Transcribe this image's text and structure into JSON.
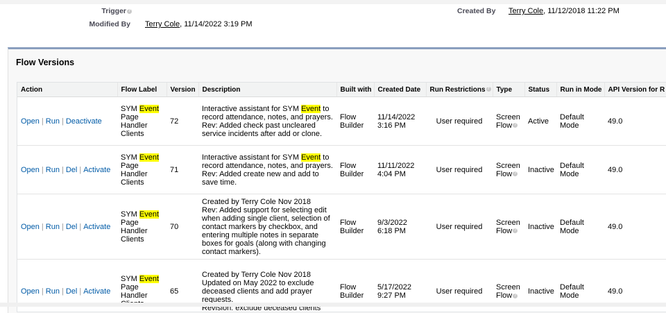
{
  "detail": {
    "trigger_label": "Trigger",
    "created_by_label": "Created By",
    "created_by_user": "Terry Cole",
    "created_by_date": ", 11/12/2018 11:22 PM",
    "modified_by_label": "Modified By",
    "modified_by_user": "Terry Cole",
    "modified_by_date": ", 11/14/2022 3:19 PM"
  },
  "section": {
    "title": "Flow Versions"
  },
  "table": {
    "headers": {
      "action": "Action",
      "flow_label": "Flow Label",
      "version": "Version",
      "description": "Description",
      "built_with": "Built with",
      "created_date": "Created Date",
      "run_restrictions": "Run Restrictions",
      "type": "Type",
      "status": "Status",
      "run_in_mode": "Run in Mode",
      "api_version": "API Version for R"
    },
    "action_labels": {
      "open": "Open",
      "run": "Run",
      "deactivate": "Deactivate",
      "del": "Del",
      "activate": "Activate"
    },
    "highlight_term": "Event",
    "rows": [
      {
        "label_pre": "SYM ",
        "label_post": " Page Handler Clients",
        "version": "72",
        "desc_pre": "Interactive assistant for SYM ",
        "desc_post": " to record attendance, notes, and prayers.",
        "desc_rev": "Rev: Added check past uncleared service incidents after add or clone.",
        "built_with": "Flow Builder",
        "created_date": "11/14/2022 3:16 PM",
        "run_restrictions": "User required",
        "type": "Screen Flow",
        "status": "Active",
        "run_in_mode": "Default Mode",
        "api_version": "49.0"
      },
      {
        "label_pre": "SYM ",
        "label_post": " Page Handler Clients",
        "version": "71",
        "desc_pre": "Interactive assistant for SYM ",
        "desc_post": " to record attendance, notes, and prayers.",
        "desc_rev": "Rev: Added create new and add to save time.",
        "built_with": "Flow Builder",
        "created_date": "11/11/2022 4:04 PM",
        "run_restrictions": "User required",
        "type": "Screen Flow",
        "status": "Inactive",
        "run_in_mode": "Default Mode",
        "api_version": "49.0"
      },
      {
        "label_pre": "SYM ",
        "label_post": " Page Handler Clients",
        "version": "70",
        "desc_line1": "Created by Terry Cole Nov 2018",
        "desc_line2": "Rev: Added support for selecting edit when adding single client, selection of contact markers by checkbox, and entering multiple notes in separate boxes for goals (along with changing contact markers).",
        "built_with": "Flow Builder",
        "created_date": "9/3/2022 6:18 PM",
        "run_restrictions": "User required",
        "type": "Screen Flow",
        "status": "Inactive",
        "run_in_mode": "Default Mode",
        "api_version": "49.0"
      },
      {
        "label_pre": "SYM ",
        "label_post": " Page Handler Clients",
        "version": "65",
        "desc_line1": "Created by Terry Cole Nov 2018",
        "desc_line2": "Updated on May 2022 to exclude deceased clients and add prayer requests.",
        "desc_line3": "Revision: exclude deceased clients",
        "built_with": "Flow Builder",
        "created_date": "5/17/2022 9:27 PM",
        "run_restrictions": "User required",
        "type": "Screen Flow",
        "status": "Inactive",
        "run_in_mode": "Default Mode",
        "api_version": "49.0"
      }
    ]
  }
}
